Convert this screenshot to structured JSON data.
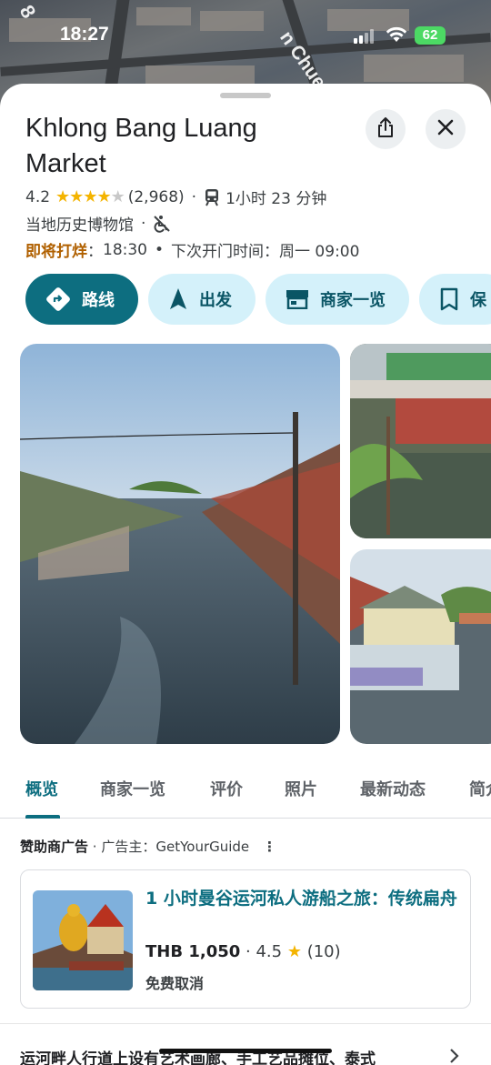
{
  "status_bar": {
    "time": "18:27",
    "battery": "62"
  },
  "map": {
    "road_label_left": "8",
    "road_label_right": "n Chuen Ch"
  },
  "place": {
    "name": "Khlong Bang Luang Market",
    "rating": "4.2",
    "rating_stars": 4.2,
    "review_count": "(2,968)",
    "transit_time": "1小时 23 分钟",
    "category": "当地历史博物馆",
    "closing_label": "即将打烊",
    "closing_time": "18:30",
    "next_open": "下次开门时间：周一 09:00"
  },
  "actions": [
    {
      "label": "路线",
      "icon": "directions-icon"
    },
    {
      "label": "出发",
      "icon": "navigation-arrow-icon"
    },
    {
      "label": "商家一览",
      "icon": "storefront-icon"
    },
    {
      "label": "保",
      "icon": "bookmark-icon"
    }
  ],
  "tabs": [
    "概览",
    "商家一览",
    "评价",
    "照片",
    "最新动态",
    "简介"
  ],
  "sponsored": {
    "label": "赞助商广告",
    "advertiser_prefix": "广告主：",
    "advertiser": "GetYourGuide",
    "title": "1 小时曼谷运河私人游船之旅：传统扁舟",
    "price": "THB 1,050",
    "rating": "4.5",
    "review_count": "(10)",
    "cancellation": "免费取消"
  },
  "description": "运河畔人行道上设有艺术画廊、手工艺品摊位、泰式",
  "colors": {
    "accent": "#0d6e80",
    "chip_bg": "#d4f1fa",
    "star": "#f4b400",
    "closing": "#b06000"
  }
}
